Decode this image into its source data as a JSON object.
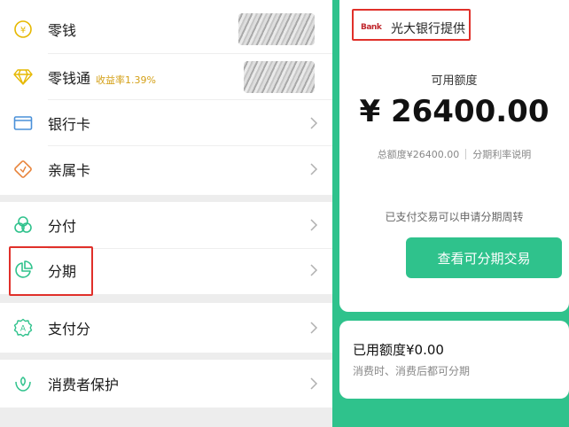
{
  "wallet_list": {
    "group1": [
      {
        "label": "零钱",
        "icon": "coin-icon"
      },
      {
        "label": "零钱通",
        "badge": "收益率1.39%",
        "icon": "diamond-icon"
      },
      {
        "label": "银行卡",
        "icon": "card-icon"
      },
      {
        "label": "亲属卡",
        "icon": "heart-card-icon"
      }
    ],
    "group2": [
      {
        "label": "分付",
        "icon": "clover-icon"
      },
      {
        "label": "分期",
        "icon": "pie-chart-icon"
      }
    ],
    "group3": [
      {
        "label": "支付分",
        "icon": "score-icon"
      }
    ],
    "group4": [
      {
        "label": "消费者保护",
        "icon": "shield-hands-icon"
      }
    ]
  },
  "installment": {
    "bank_logo": "Bank",
    "bank_name": "光大银行提供",
    "available_label": "可用额度",
    "available_amount": "¥ 26400.00",
    "total_limit": "总额度¥26400.00",
    "rate_link": "分期利率说明",
    "note": "已支付交易可以申请分期周转",
    "view_button": "查看可分期交易",
    "used_amount": "已用额度¥0.00",
    "used_note": "消费时、消费后都可分期"
  },
  "colors": {
    "accent": "#2fc28c",
    "highlight": "#e0302a",
    "icon_yellow": "#e6b800",
    "icon_blue": "#4a90d9",
    "icon_orange": "#e8833a"
  }
}
